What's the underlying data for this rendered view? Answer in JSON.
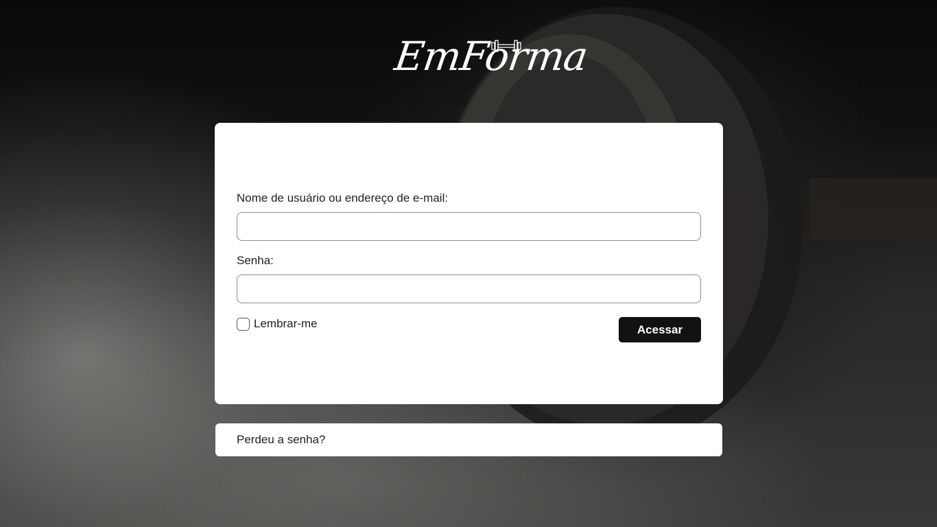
{
  "brand": {
    "logo_text": "EmForma",
    "logo_icon": "dumbbell-icon"
  },
  "login_form": {
    "username_label": "Nome de usuário ou endereço de e-mail:",
    "username_value": "",
    "password_label": "Senha:",
    "password_value": "",
    "remember_label": "Lembrar-me",
    "remember_checked": false,
    "submit_label": "Acessar"
  },
  "lost_password": {
    "link_text": "Perdeu a senha?"
  },
  "colors": {
    "button_bg": "#121212",
    "card_bg": "#ffffff",
    "text": "#1f1f1f"
  }
}
